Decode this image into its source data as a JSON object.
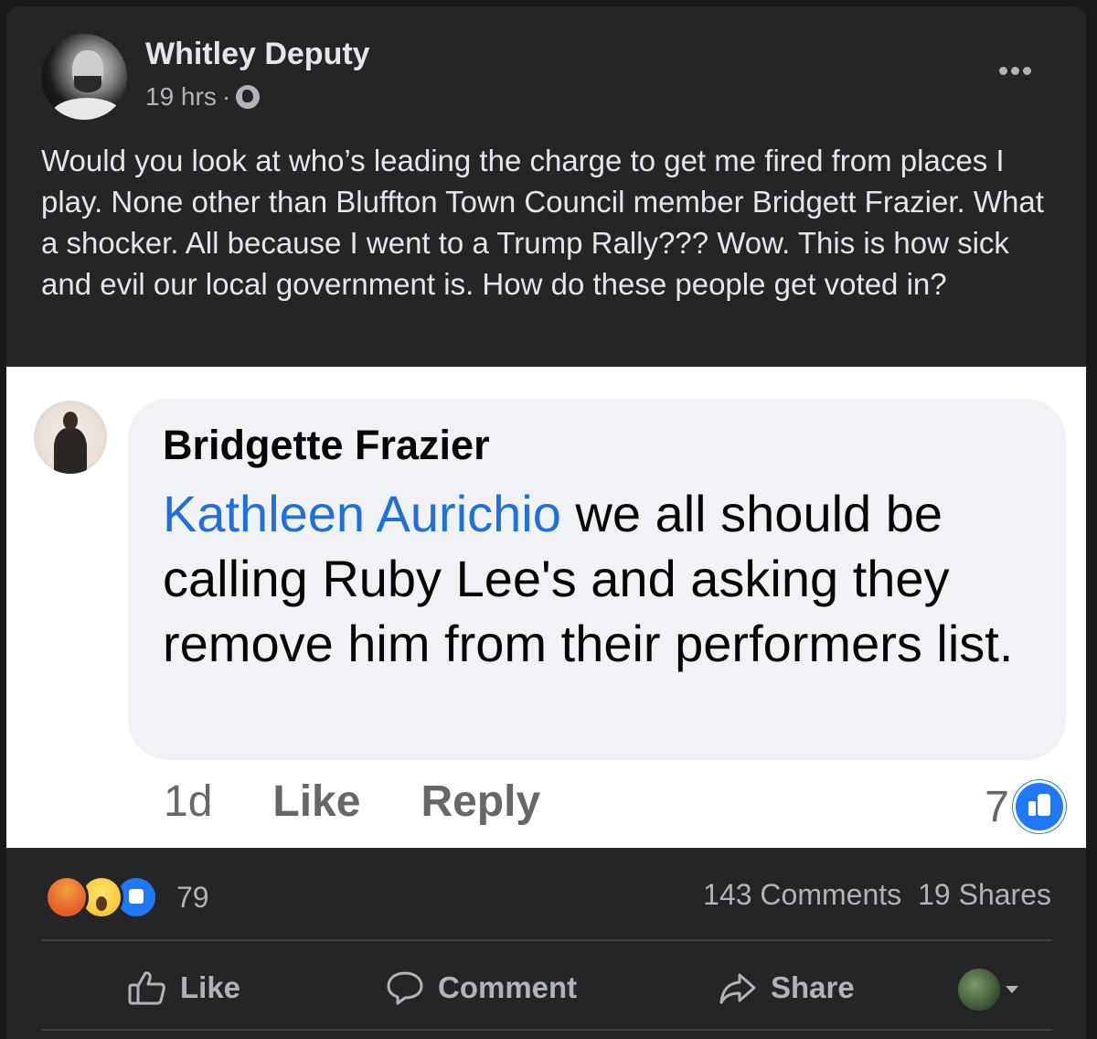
{
  "post": {
    "author": "Whitley Deputy",
    "time": "19 hrs",
    "separator": "·",
    "privacy_icon": "globe-icon",
    "text": "Would you look at who’s leading the charge to get me fired from places I play. None other than Bluffton Town Council member Bridgett Frazier. What a shocker. All because I went to a Trump Rally??? Wow. This is how sick and evil our local government is. How do these people get voted in?"
  },
  "embedded_comment": {
    "author": "Bridgette Frazier",
    "mention": "Kathleen Aurichio",
    "text": " we all should be calling Ruby Lee's and asking they remove him from their performers list.",
    "time": "1d",
    "like_label": "Like",
    "reply_label": "Reply",
    "like_count": "7"
  },
  "stats": {
    "reaction_icons": [
      "angry-icon",
      "wow-icon",
      "like-icon"
    ],
    "reaction_count": "79",
    "comments": "143 Comments",
    "shares": "19 Shares"
  },
  "actions": {
    "like": "Like",
    "comment": "Comment",
    "share": "Share"
  },
  "colors": {
    "background": "#242526",
    "text": "#e4e6eb",
    "secondary": "#b0b3b8",
    "link": "#216fdb",
    "like_blue": "#2078f4"
  }
}
